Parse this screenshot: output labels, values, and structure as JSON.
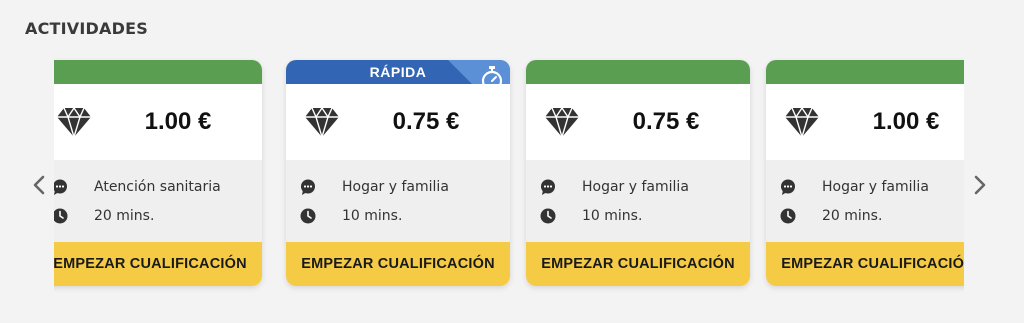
{
  "section": {
    "title": "ACTIVIDADES"
  },
  "nav": {
    "prev_icon": "chevron-left-icon",
    "next_icon": "chevron-right-icon"
  },
  "colors": {
    "header_green": "#5a9e52",
    "header_blue": "#3266b4",
    "action_yellow": "#f5cb45"
  },
  "cards": [
    {
      "price": "1.00 €",
      "category": "Atención sanitaria",
      "duration": "20 mins.",
      "action": "EMPEZAR CUALIFICACIÓN",
      "header_label": ""
    },
    {
      "price": "0.75 €",
      "category": "Hogar y familia",
      "duration": "10 mins.",
      "action": "EMPEZAR CUALIFICACIÓN",
      "header_label": "RÁPIDA",
      "badge_icon": "stopwatch-icon"
    },
    {
      "price": "0.75 €",
      "category": "Hogar y familia",
      "duration": "10 mins.",
      "action": "EMPEZAR CUALIFICACIÓN",
      "header_label": ""
    },
    {
      "price": "1.00 €",
      "category": "Hogar y familia",
      "duration": "20 mins.",
      "action": "EMPEZAR CUALIFICACIÓN",
      "header_label": ""
    }
  ]
}
